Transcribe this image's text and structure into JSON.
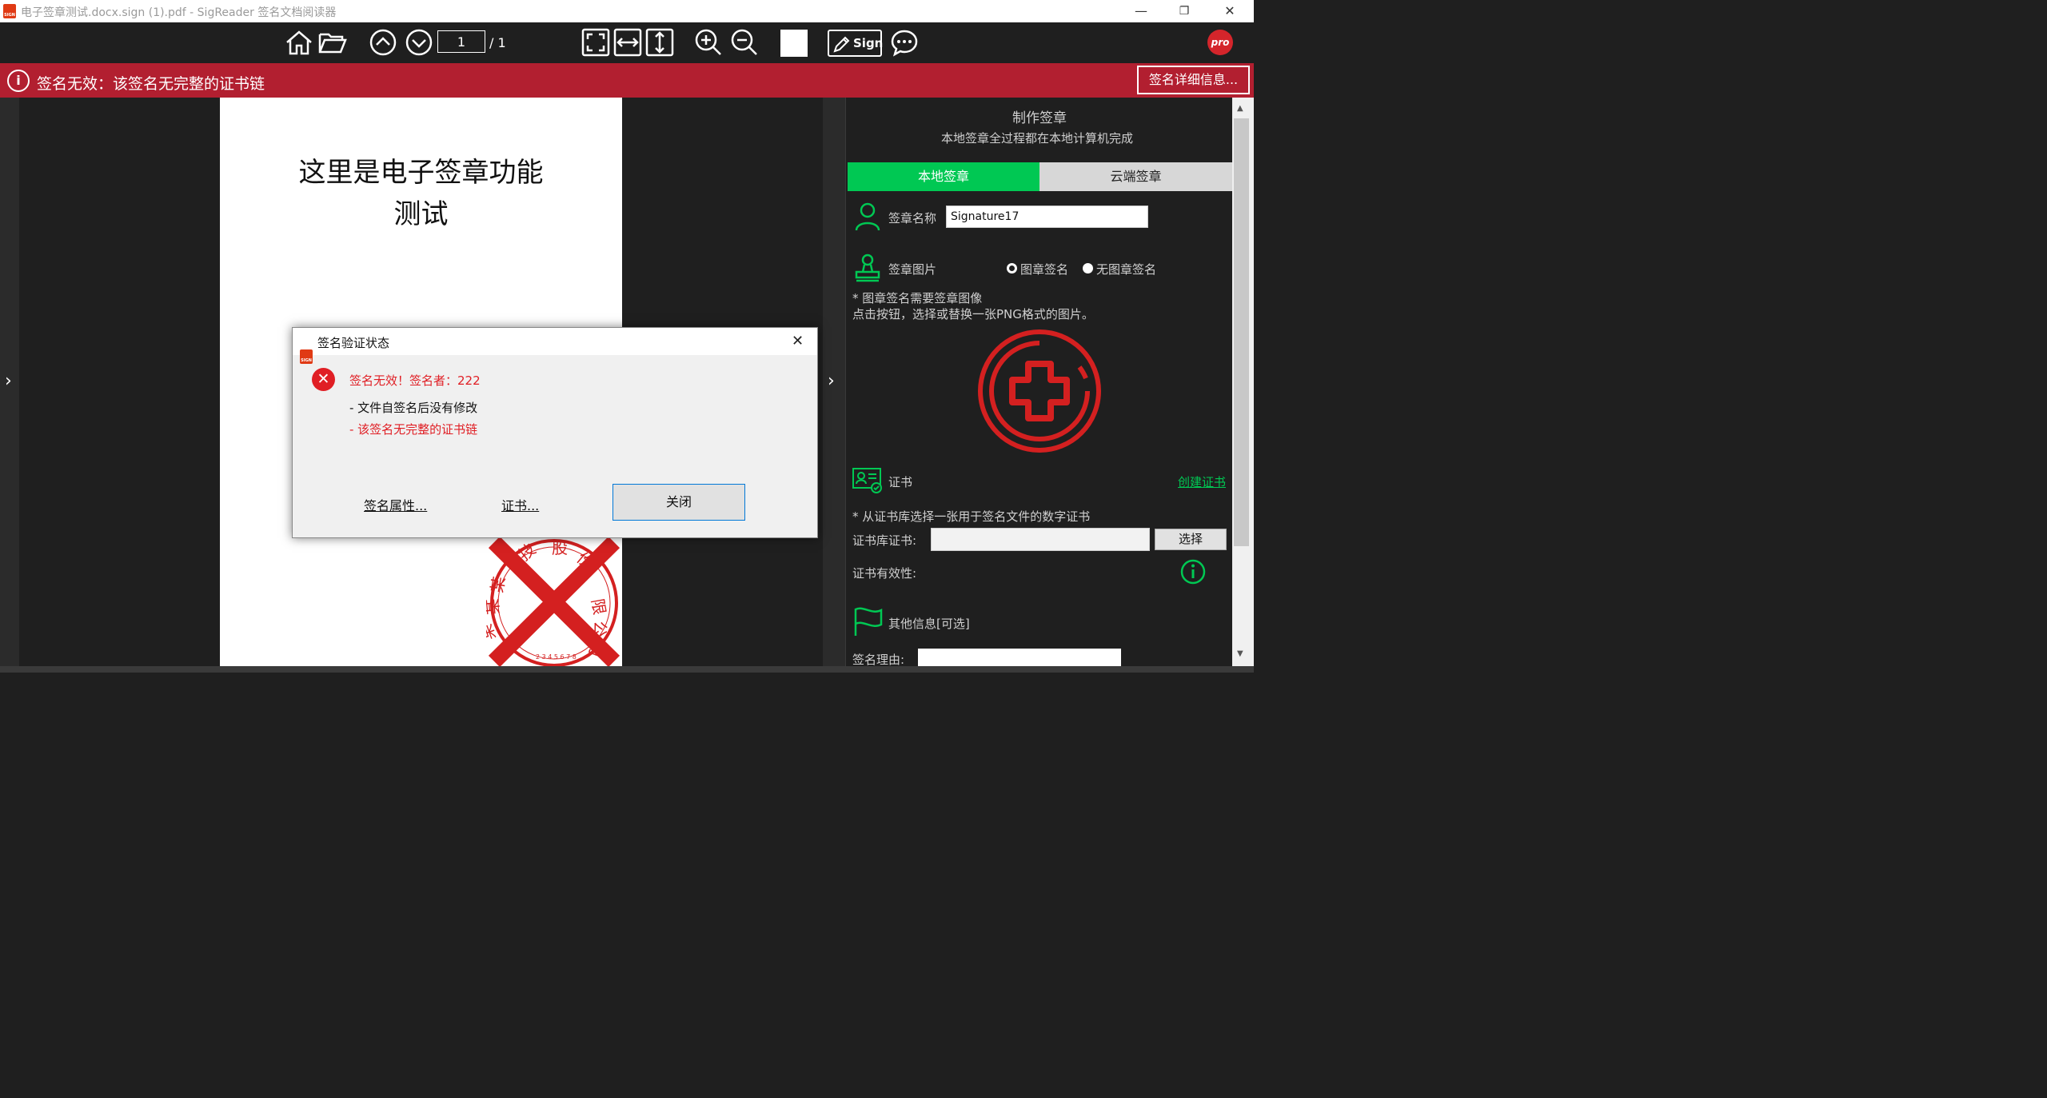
{
  "window": {
    "title": "电子签章测试.docx.sign (1).pdf - SigReader 签名文档阅读器",
    "minimize": "—",
    "restore": "❐",
    "close": "✕"
  },
  "toolbar": {
    "page_current": "1",
    "page_total": "/ 1",
    "sign_label": "Sign",
    "pro_label": "pro"
  },
  "banner": {
    "message": "签名无效：该签名无完整的证书链",
    "detail_button": "签名详细信息..."
  },
  "document": {
    "title_line1": "这里是电子签章功能",
    "title_line2": "测试"
  },
  "panel": {
    "header": "制作签章",
    "subheader": "本地签章全过程都在本地计算机完成",
    "tabs": [
      "本地签章",
      "云端签章"
    ],
    "sig_name_label": "签章名称",
    "sig_name_value": "Signature17",
    "sig_image_label": "签章图片",
    "radio_image": "图章签名",
    "radio_no_image": "无图章签名",
    "note_line1": "* 图章签名需要签章图像",
    "note_line2": "点击按钮，选择或替换一张PNG格式的图片。",
    "cert_label": "证书",
    "create_cert_link": "创建证书",
    "cert_note": "* 从证书库选择一张用于签名文件的数字证书",
    "cert_store_label": "证书库证书:",
    "select_button": "选择",
    "cert_validity_label": "证书有效性:",
    "other_info_label": "其他信息[可选]",
    "reason_label": "签名理由:"
  },
  "dialog": {
    "title": "签名验证状态",
    "line1": "签名无效！签名者：222",
    "line2": "- 文件自签名后没有修改",
    "line3": "- 该签名无完整的证书链",
    "props_link": "签名属性...",
    "cert_link": "证书...",
    "close_button": "关闭"
  },
  "stamp_text": [
    "技",
    "股",
    "份",
    "限",
    "公",
    "司",
    "某",
    "某",
    "某"
  ],
  "stamp_number": "2 3 4 5 6 7 8",
  "colors": {
    "banner_red": "#b21f30",
    "accent_green": "#00c853",
    "error_red": "#e01e24",
    "stamp_red": "#d42020"
  }
}
